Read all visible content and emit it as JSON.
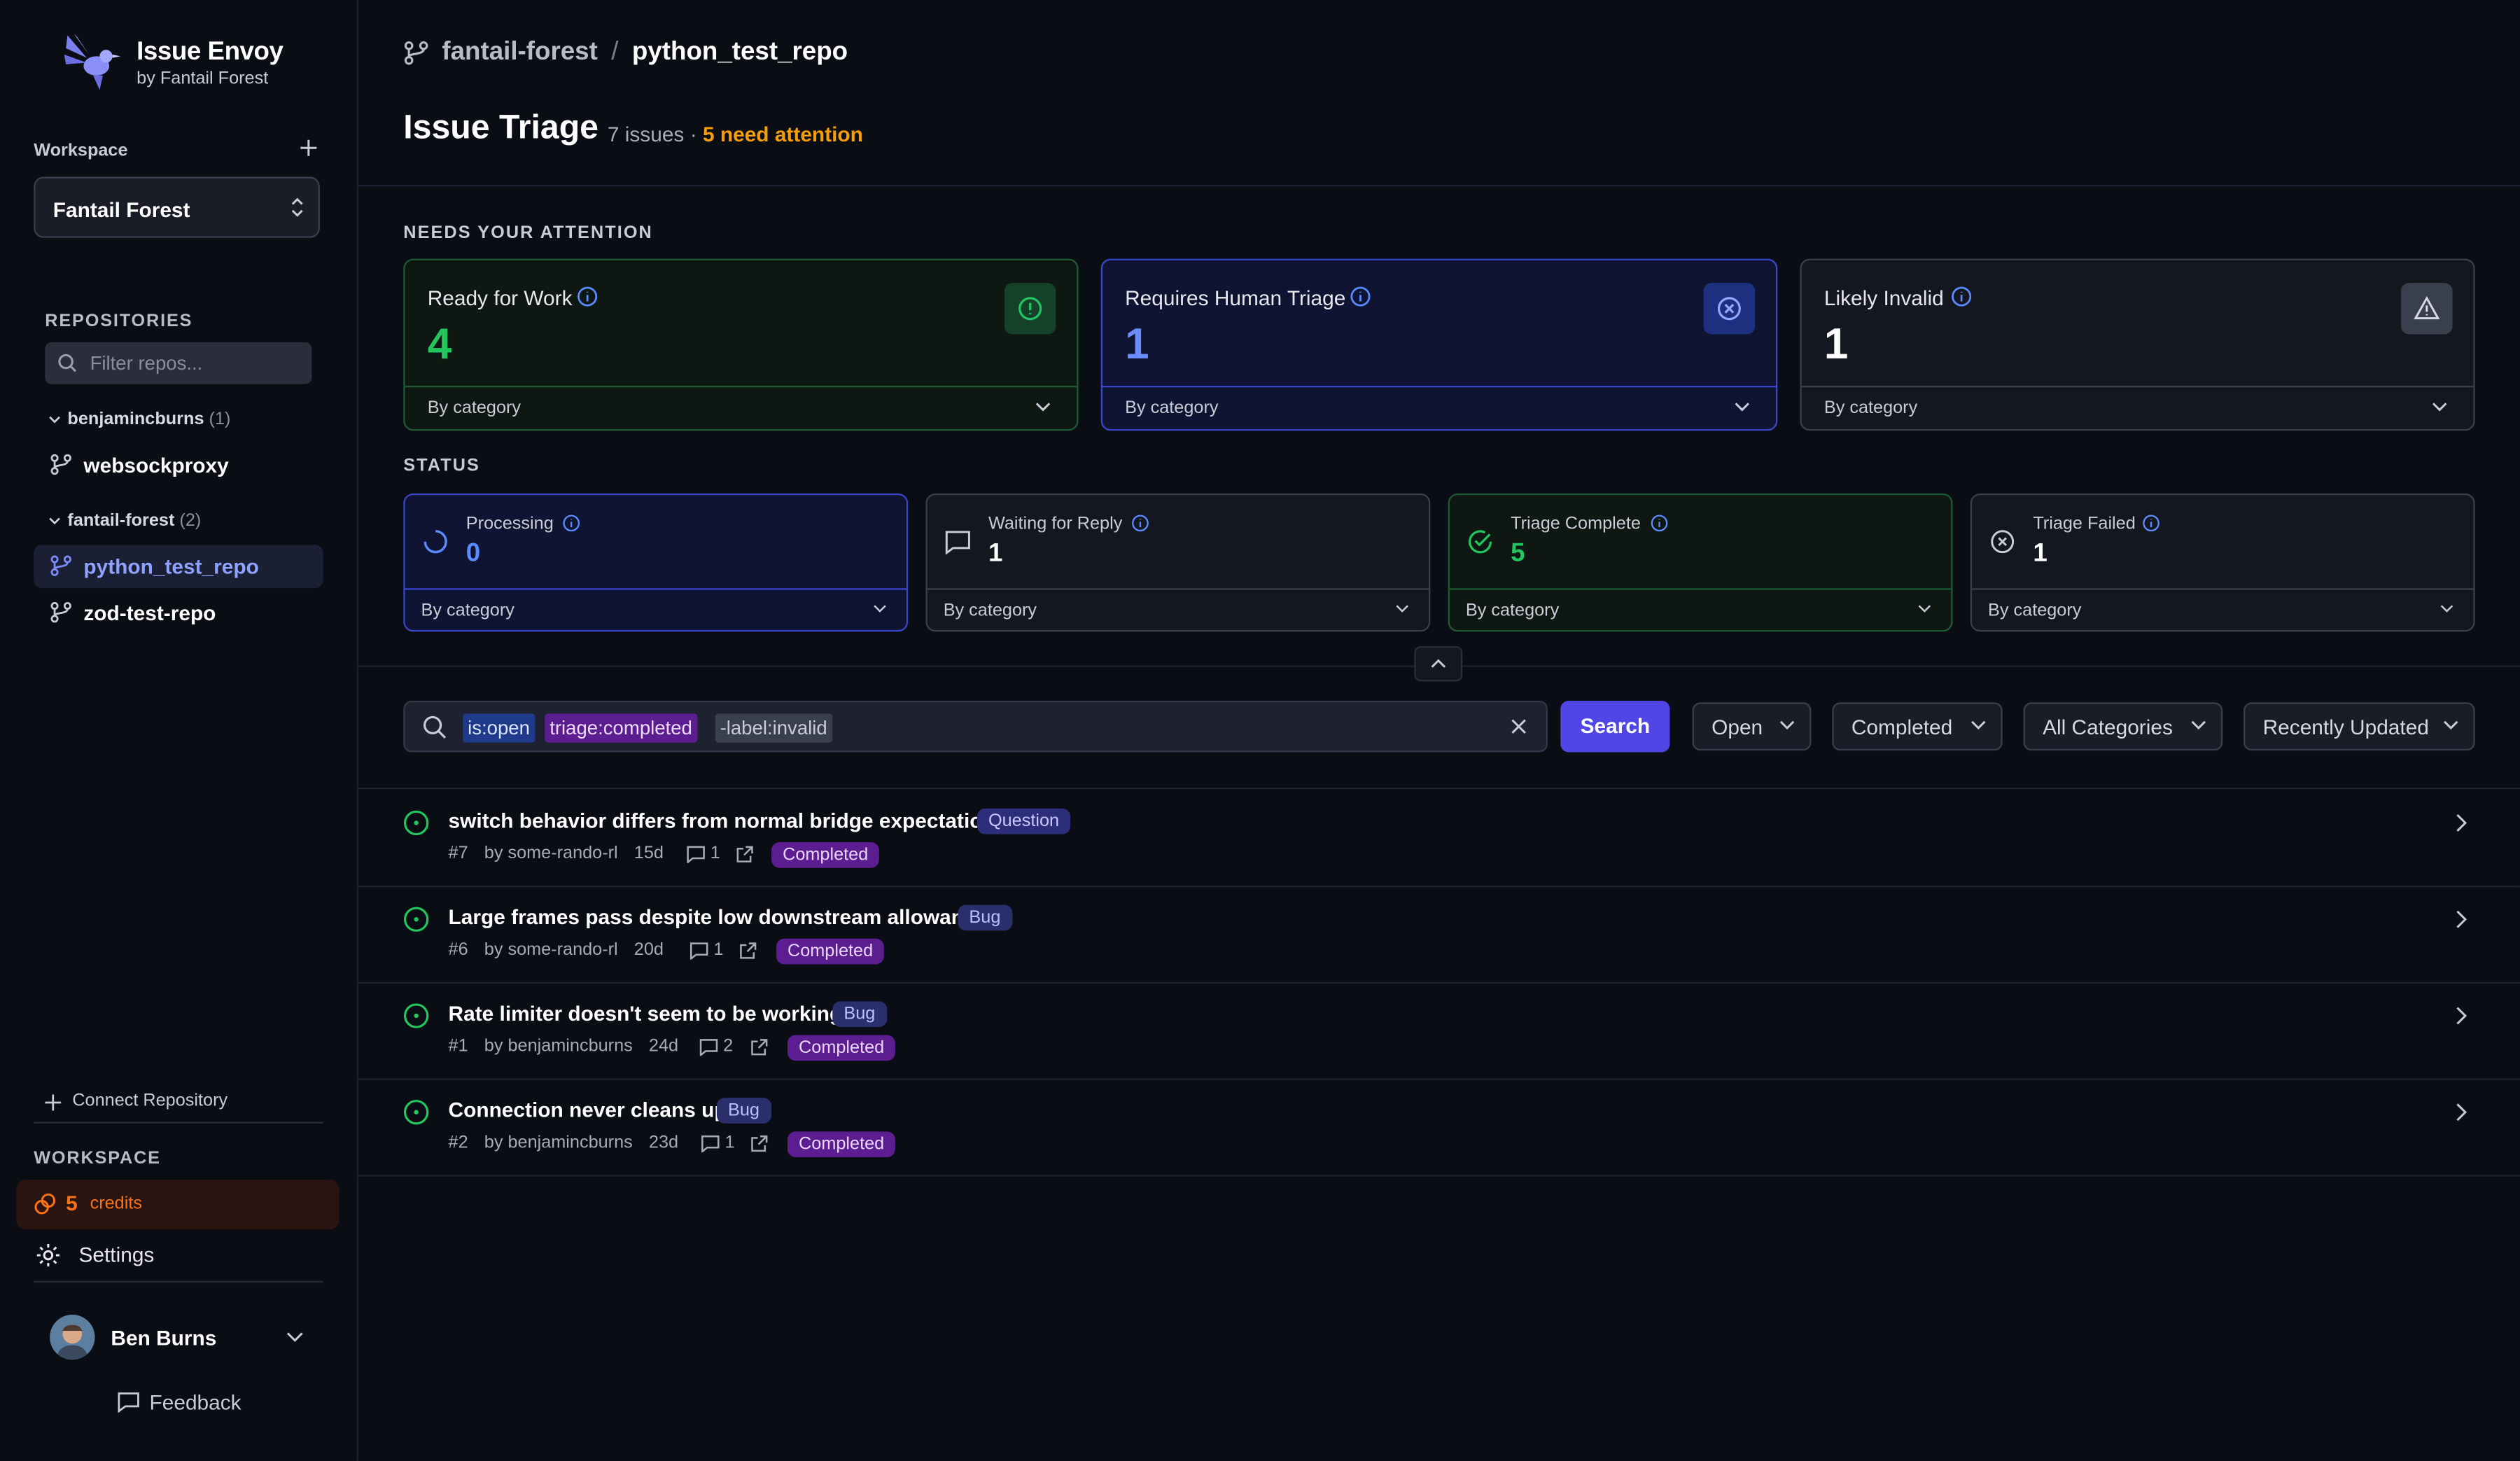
{
  "brand": {
    "name": "Issue Envoy",
    "subtitle": "by Fantail Forest"
  },
  "sidebar": {
    "workspace_label": "Workspace",
    "workspace_selected": "Fantail Forest",
    "repositories_label": "REPOSITORIES",
    "filter_placeholder": "Filter repos...",
    "groups": [
      {
        "owner": "benjamincburns",
        "count": "(1)",
        "repos": [
          "websockproxy"
        ]
      },
      {
        "owner": "fantail-forest",
        "count": "(2)",
        "repos": [
          "python_test_repo",
          "zod-test-repo"
        ]
      }
    ],
    "active_repo": "python_test_repo",
    "connect_repository": "Connect Repository",
    "workspace_section": "WORKSPACE",
    "credits_count": "5",
    "credits_label": "credits",
    "settings": "Settings",
    "user_name": "Ben Burns",
    "feedback": "Feedback"
  },
  "header": {
    "org": "fantail-forest",
    "separator": "/",
    "repo": "python_test_repo",
    "title": "Issue Triage",
    "issue_count": "7 issues",
    "dot": "·",
    "attention": "5 need attention"
  },
  "attention": {
    "label": "NEEDS YOUR ATTENTION",
    "cards": [
      {
        "title": "Ready for Work",
        "value": "4",
        "footer": "By category"
      },
      {
        "title": "Requires Human Triage",
        "value": "1",
        "footer": "By category"
      },
      {
        "title": "Likely Invalid",
        "value": "1",
        "footer": "By category"
      }
    ]
  },
  "status": {
    "label": "STATUS",
    "cards": [
      {
        "title": "Processing",
        "value": "0",
        "footer": "By category"
      },
      {
        "title": "Waiting for Reply",
        "value": "1",
        "footer": "By category"
      },
      {
        "title": "Triage Complete",
        "value": "5",
        "footer": "By category"
      },
      {
        "title": "Triage Failed",
        "value": "1",
        "footer": "By category"
      }
    ]
  },
  "search": {
    "tokens": [
      "is:open",
      "triage:completed",
      "-label:invalid"
    ],
    "button": "Search",
    "filters": [
      "Open",
      "Completed",
      "All Categories",
      "Recently Updated"
    ]
  },
  "issues": [
    {
      "title": "switch behavior differs from normal bridge expectations",
      "label": "Question",
      "number": "#7",
      "author": "by some-rando-rl",
      "age": "15d",
      "comments": "1",
      "status": "Completed"
    },
    {
      "title": "Large frames pass despite low downstream allowance",
      "label": "Bug",
      "number": "#6",
      "author": "by some-rando-rl",
      "age": "20d",
      "comments": "1",
      "status": "Completed"
    },
    {
      "title": "Rate limiter doesn't seem to be working.",
      "label": "Bug",
      "number": "#1",
      "author": "by benjamincburns",
      "age": "24d",
      "comments": "2",
      "status": "Completed"
    },
    {
      "title": "Connection never cleans up",
      "label": "Bug",
      "number": "#2",
      "author": "by benjamincburns",
      "age": "23d",
      "comments": "1",
      "status": "Completed"
    }
  ],
  "colors": {
    "accent": "#4f46e5",
    "green": "#22c55e",
    "blue": "#5b8cff",
    "orange": "#f59e0b",
    "purple": "#5b1d8f"
  }
}
